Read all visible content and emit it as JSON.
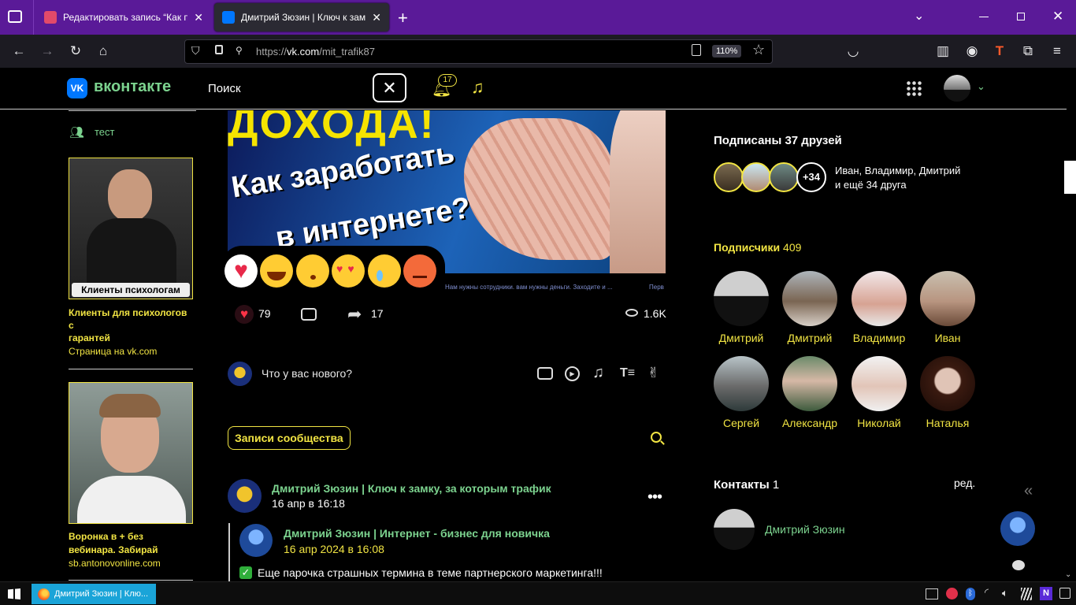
{
  "browser": {
    "tabs": [
      {
        "title": "Редактировать запись “Как по",
        "active": false
      },
      {
        "title": "Дмитрий Зюзин | Ключ к замк",
        "active": true
      }
    ],
    "url_prefix": "https://",
    "url_host": "vk.com",
    "url_path": "/mit_trafik87",
    "zoom": "110%"
  },
  "vk": {
    "logo_text": "вконтакте",
    "search_label": "Поиск",
    "notifications_count": "17"
  },
  "left": {
    "group_link": "тест",
    "ad1": {
      "badge": "Клиенты психологам",
      "title": "Клиенты для психологов с гарантей",
      "title_l1": "Клиенты для психологов",
      "title_l2": "с",
      "title_l3": "гарантей",
      "domain": "Страница на vk.com"
    },
    "ad2": {
      "title_l1": "Воронка в + без",
      "title_l2": "вебинара. Забирай",
      "domain": "sb.antonovonline.com"
    }
  },
  "post": {
    "banner_line1": "ДОХОДА!",
    "banner_line2": "Как заработать",
    "banner_line3": "в интернете?",
    "caption": "Нам нужны сотрудники. вам нужны деньги. Заходите и ...",
    "caption_right": "Перв",
    "likes": "79",
    "shares": "17",
    "views": "1.6K"
  },
  "composer": {
    "placeholder": "Что у вас нового?"
  },
  "wall": {
    "tab_label": "Записи сообщества",
    "entry": {
      "author": "Дмитрий Зюзин | Ключ к замку, за которым трафик",
      "date": "16 апр в 16:18",
      "repost_author": "Дмитрий Зюзин | Интернет - бизнес для новичка",
      "repost_date": "16 апр 2024 в 16:08",
      "text": "Еще парочка страшных термина в теме партнерского маркетинга!!!"
    }
  },
  "right": {
    "friends_title": "Подписаны 37 друзей",
    "friends_more": "+34",
    "friends_text_l1": "Иван, Владимир, Дмитрий",
    "friends_text_l2": "и ещё 34 друга",
    "subs_title": "Подписчики",
    "subs_count": "409",
    "subscribers": [
      "Дмитрий",
      "Дмитрий",
      "Владимир",
      "Иван",
      "Сергей",
      "Александр",
      "Николай",
      "Наталья"
    ],
    "contacts_title": "Контакты",
    "contacts_count": "1",
    "contacts_edit": "ред.",
    "contact_name": "Дмитрий Зюзин"
  },
  "taskbar": {
    "app_title": "Дмитрий Зюзин | Клю..."
  },
  "colors": {
    "accent": "#f1e443",
    "green": "#7cd38f",
    "browser_tab": "#5a1a98"
  }
}
